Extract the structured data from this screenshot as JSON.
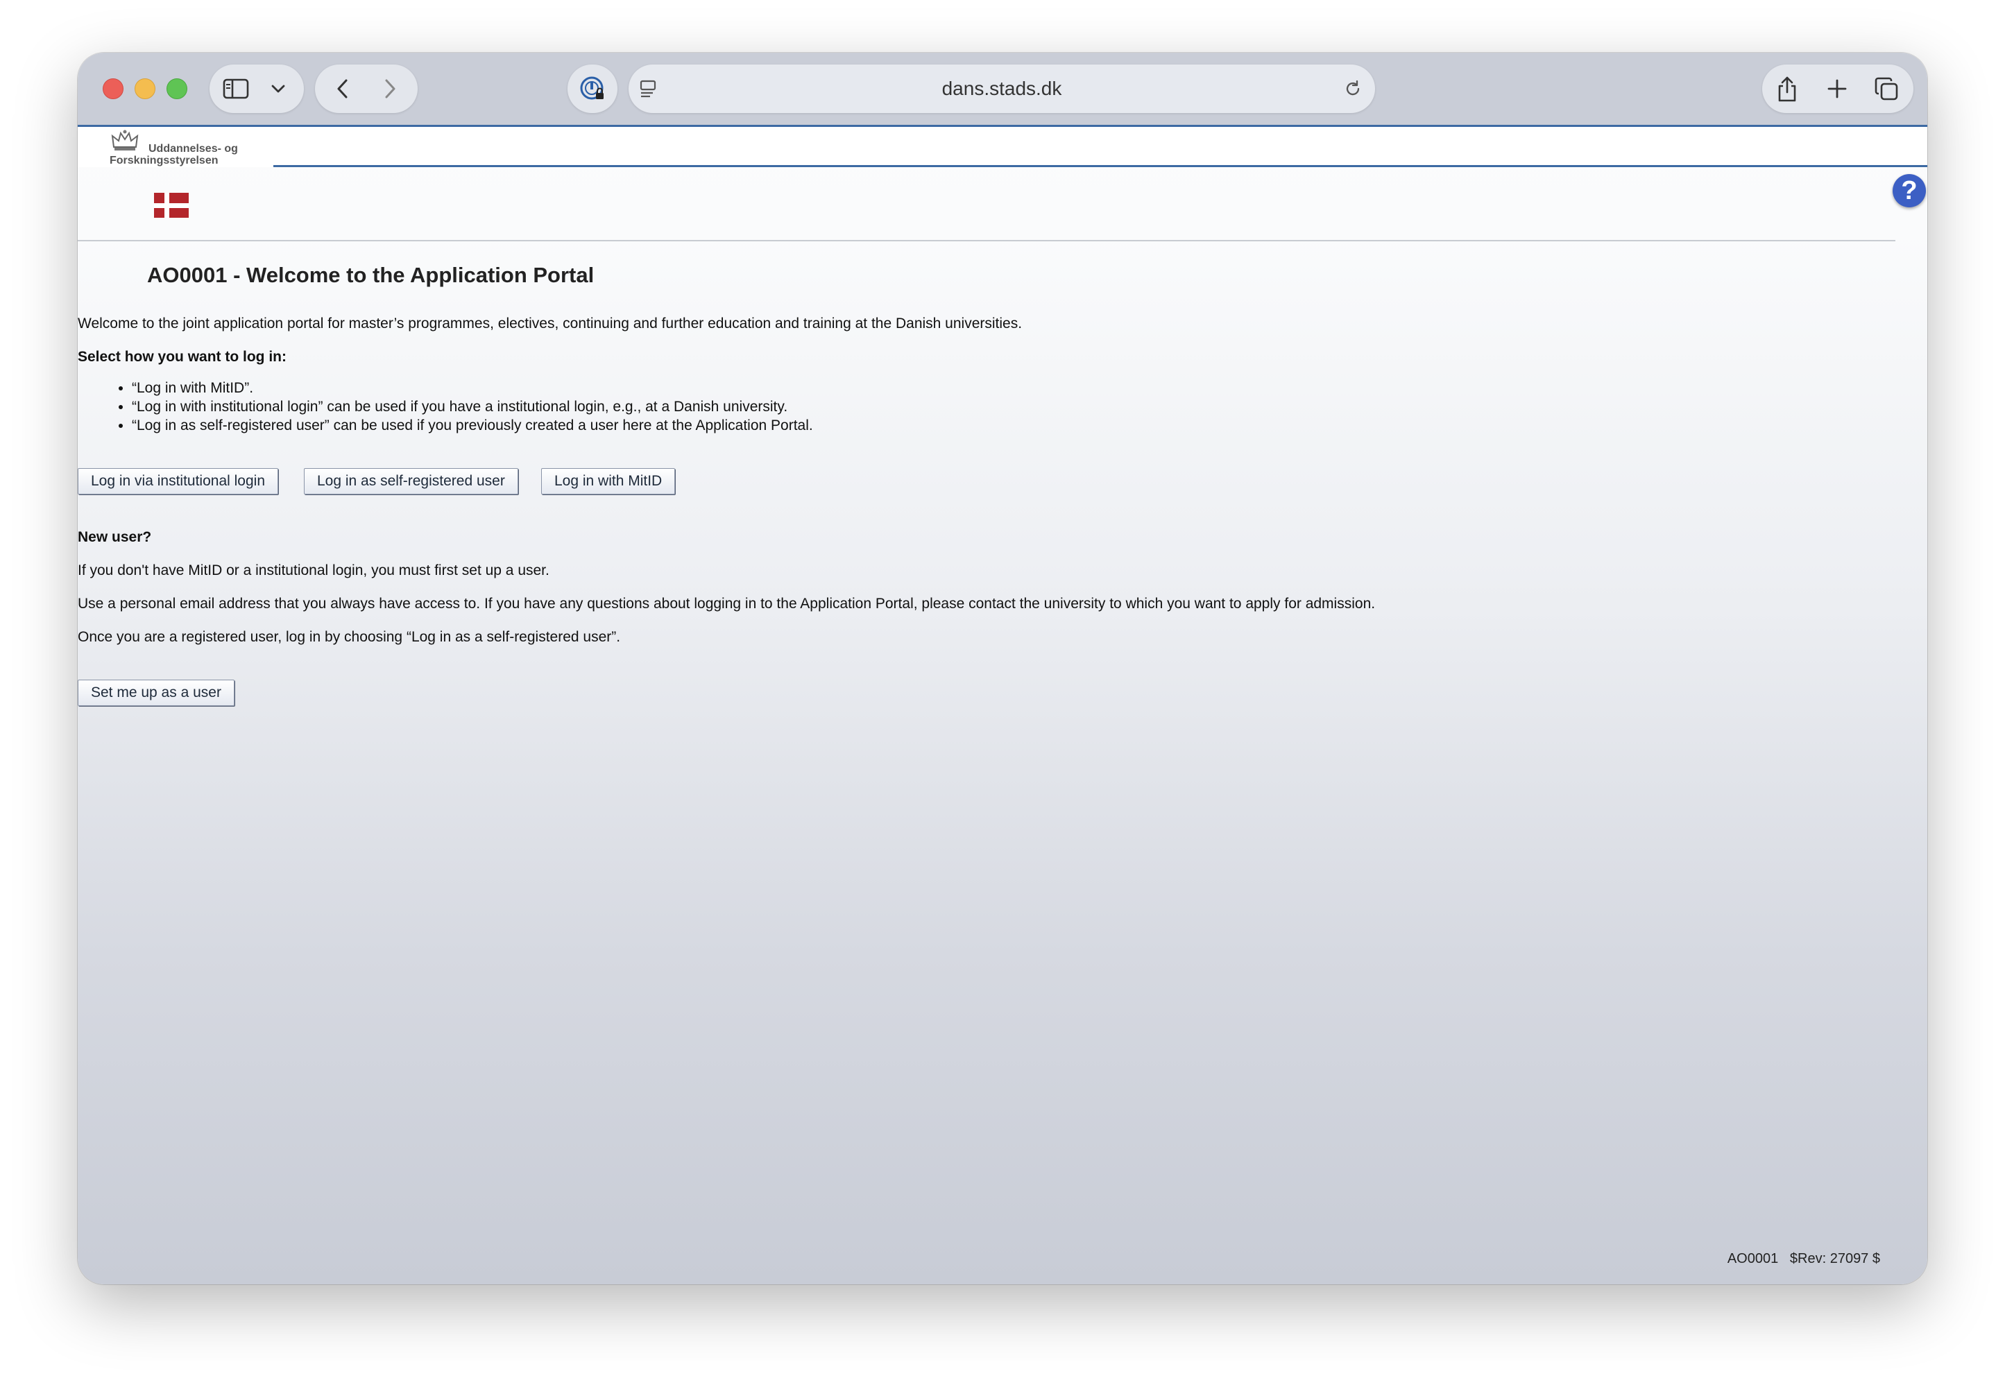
{
  "browser": {
    "url": "dans.stads.dk"
  },
  "header": {
    "logo_line1": "Uddannelses- og",
    "logo_line2": "Forskningsstyrelsen",
    "help_label": "?"
  },
  "page": {
    "title": "AO0001 - Welcome to the Application Portal",
    "intro": "Welcome to the joint application portal for master’s programmes, electives, continuing and further education and training at the Danish universities.",
    "select_heading": "Select how you want to log in:",
    "options": [
      "“Log in with MitID”.",
      "“Log in with institutional login” can be used if you have a institutional login, e.g., at a Danish university.",
      "“Log in as self-registered user” can be used if you previously created a user here at the Application Portal."
    ],
    "buttons": {
      "institutional": "Log in via institutional login",
      "self_registered": "Log in as self-registered user",
      "mitid": "Log in with MitID"
    },
    "new_user_heading": "New user?",
    "new_user_p1": "If you don't have MitID or a institutional login, you must first set up a user.",
    "new_user_p2": "Use a personal email address that you always have access to. If you have any questions about logging in to the Application Portal, please contact the university to which you want to apply for admission.",
    "new_user_p3": "Once you are a registered user, log in by choosing “Log in as a self-registered user”.",
    "setup_button": "Set me up as a user"
  },
  "footer": {
    "code": "AO0001",
    "rev": "$Rev: 27097 $"
  },
  "colors": {
    "accent_line": "#3d6aa3",
    "help_button": "#3c5fc4"
  }
}
